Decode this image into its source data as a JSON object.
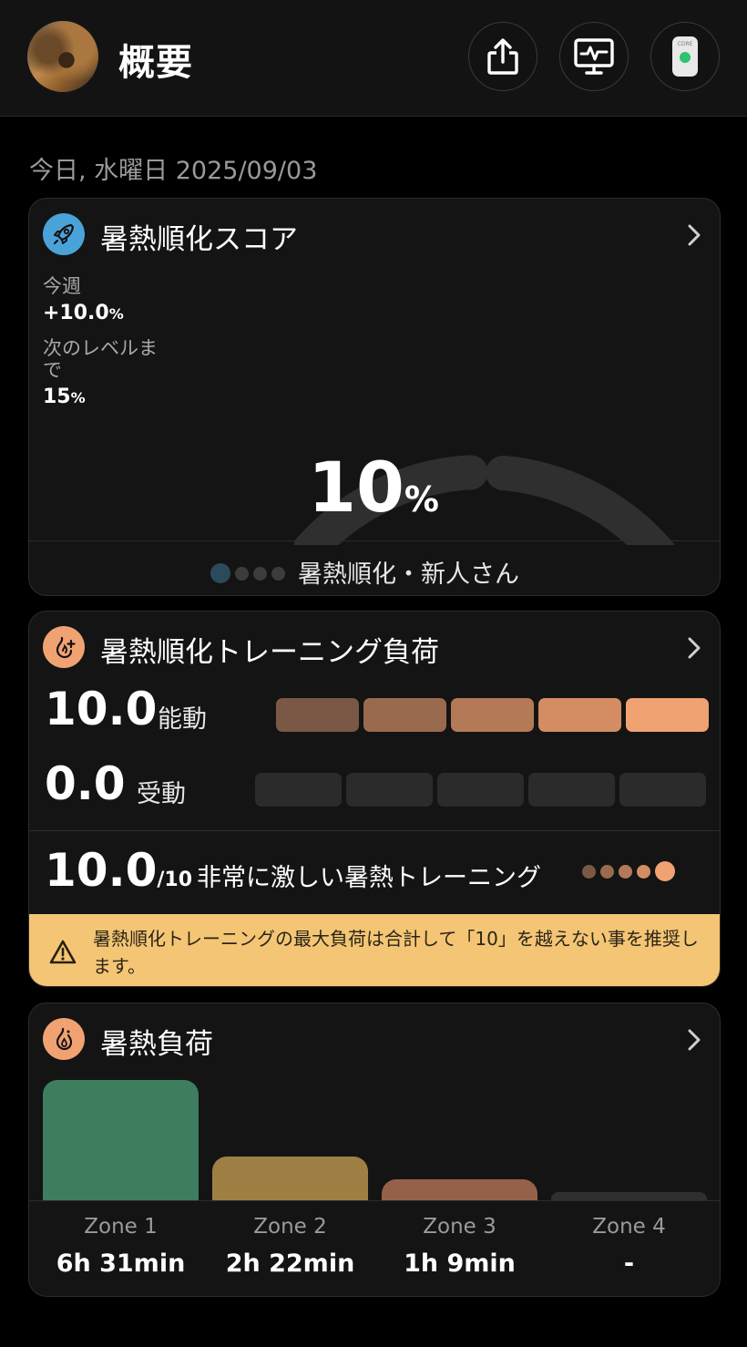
{
  "header": {
    "title": "概要",
    "buttons": [
      "share-icon",
      "monitor-pulse-icon",
      "core-sensor-icon"
    ],
    "sensor_text": "CORE"
  },
  "date": "今日, 水曜日 2025/09/03",
  "acclimation": {
    "title": "暑熱順化スコア",
    "icon": "rocket-icon",
    "week_label": "今週",
    "week_value": "+10.0",
    "week_unit": "%",
    "next_label_line1": "次のレベルま",
    "next_label_line2": "で",
    "next_value": "15",
    "next_unit": "%",
    "score": "10",
    "score_unit": "%",
    "score_fraction": 0.1,
    "level_index": 1,
    "level_count": 4,
    "level_name": "暑熱順化・新人さん",
    "colors": {
      "filled": "#2b4a5c",
      "empty": "#2f2f2f",
      "icon_bg": "#4aa3d8"
    }
  },
  "training": {
    "title": "暑熱順化トレーニング負荷",
    "icon": "flame-plus-icon",
    "active_value": "10.0",
    "active_label": "能動",
    "active_filled": 5,
    "passive_value": "0.0",
    "passive_label": "受動",
    "passive_filled": 0,
    "total_value": "10.0",
    "total_max": "/10",
    "total_label": "非常に激しい暑熱トレーニング",
    "intensity_level": 5,
    "warning": "暑熱順化トレーニングの最大負荷は合計して「10」を越えない事を推奨します。",
    "colors": {
      "active": [
        "#7a5845",
        "#9a6a4e",
        "#b47a57",
        "#d48d63",
        "#f0a272"
      ],
      "empty": "#2b2b2b",
      "icon_bg": "#f0a272",
      "warning_bg": "#f4c574"
    }
  },
  "heat_load": {
    "title": "暑熱負荷",
    "icon": "flame-drop-icon",
    "zones": [
      {
        "label": "Zone 1",
        "value": "6h 31min",
        "minutes": 391,
        "color": "#3e7d5e"
      },
      {
        "label": "Zone 2",
        "value": "2h 22min",
        "minutes": 142,
        "color": "#9e8044"
      },
      {
        "label": "Zone 3",
        "value": "1h 9min",
        "minutes": 69,
        "color": "#96614a"
      },
      {
        "label": "Zone 4",
        "value": "-",
        "minutes": 0,
        "color": "#2f2f2f"
      }
    ]
  }
}
